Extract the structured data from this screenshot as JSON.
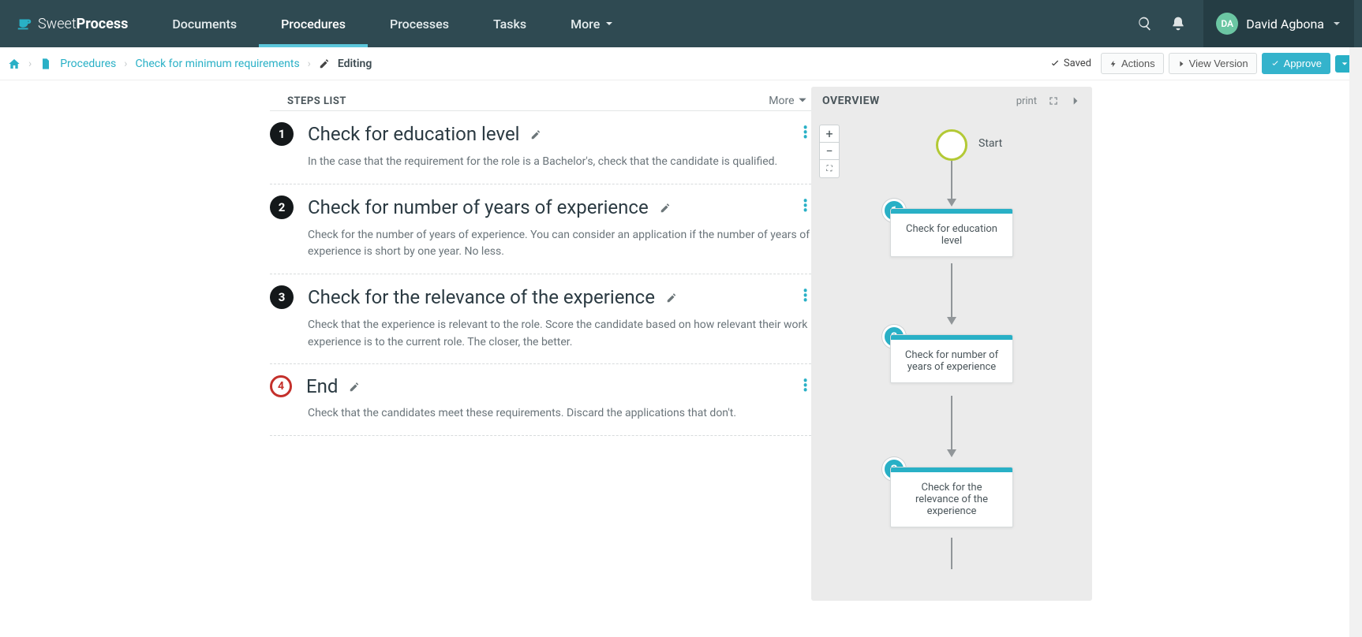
{
  "brand": {
    "thin": "Sweet",
    "bold": "Process"
  },
  "nav": {
    "items": [
      "Documents",
      "Procedures",
      "Processes",
      "Tasks",
      "More"
    ],
    "active_index": 1
  },
  "user": {
    "initials": "DA",
    "name": "David Agbona"
  },
  "breadcrumb": {
    "link1": "Procedures",
    "link2": "Check for minimum requirements",
    "editing": "Editing"
  },
  "toolbar": {
    "saved": "Saved",
    "actions": "Actions",
    "view_version": "View Version",
    "approve": "Approve"
  },
  "steps_header": {
    "title": "STEPS LIST",
    "more": "More"
  },
  "steps": [
    {
      "num": "1",
      "title": "Check for education level",
      "desc": "In the case that the requirement for the role is a Bachelor's, check that the candidate is qualified."
    },
    {
      "num": "2",
      "title": "Check for number of years of experience",
      "desc": "Check for the number of years of experience. You can consider an application if the number of years of experience is short by one year. No less."
    },
    {
      "num": "3",
      "title": "Check for the relevance of the experience",
      "desc": "Check that the experience is relevant to the role. Score the candidate based on how relevant their work experience is to the current role. The closer, the better."
    },
    {
      "num": "4",
      "title": "End",
      "desc": "Check that the candidates meet these requirements. Discard the applications that don't.",
      "end": true
    }
  ],
  "overview": {
    "title": "OVERVIEW",
    "print": "print",
    "start": "Start",
    "nodes": [
      {
        "num": "1",
        "label": "Check for education level"
      },
      {
        "num": "2",
        "label": "Check for number of years of experience"
      },
      {
        "num": "3",
        "label": "Check for the relevance of the experience"
      }
    ]
  }
}
